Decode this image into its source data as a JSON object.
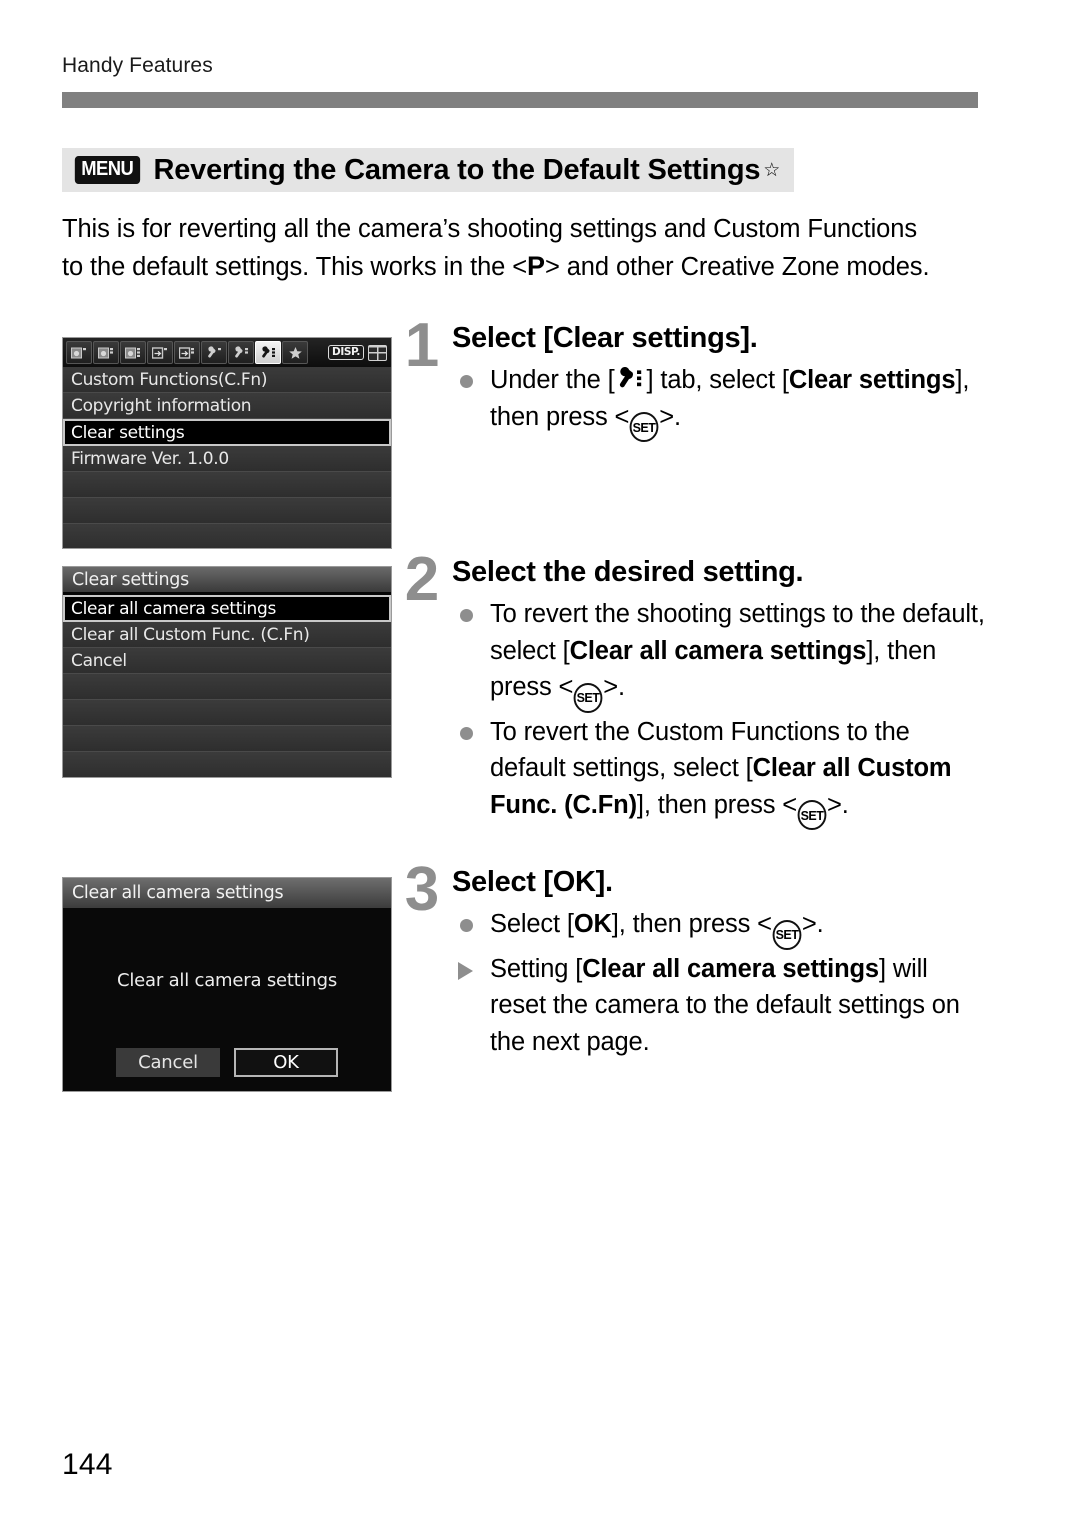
{
  "page": {
    "running_head": "Handy Features",
    "folio": "144",
    "accent_gray": "#808080",
    "title_band_bg": "#e4e4e4"
  },
  "section": {
    "menu_badge": "MENU",
    "title": "Reverting the Camera to the Default Settings",
    "star": "☆"
  },
  "intro": {
    "line1": "This is for reverting all the camera’s shooting settings and Custom",
    "line2_a": "Functions to the default settings. This works in the <",
    "mode_symbol": "P",
    "line2_b": "> and other",
    "line3": "Creative Zone modes."
  },
  "lcd1": {
    "tabs": [
      {
        "name": "shooting-1",
        "state": "dim"
      },
      {
        "name": "shooting-2",
        "state": "dim"
      },
      {
        "name": "shooting-3",
        "state": "dim"
      },
      {
        "name": "playback-1",
        "state": "dim"
      },
      {
        "name": "playback-2",
        "state": "dim"
      },
      {
        "name": "setup-1",
        "state": "dim"
      },
      {
        "name": "setup-2",
        "state": "dim"
      },
      {
        "name": "setup-3",
        "state": "active"
      },
      {
        "name": "my-menu",
        "state": "dim"
      }
    ],
    "disp_label": "DISP.",
    "rows": [
      {
        "label": "Custom Functions(C.Fn)",
        "selected": false
      },
      {
        "label": "Copyright information",
        "selected": false
      },
      {
        "label": "Clear settings",
        "selected": true
      },
      {
        "label": "Firmware Ver. 1.0.0",
        "selected": false
      },
      {
        "label": "",
        "selected": false
      },
      {
        "label": "",
        "selected": false
      },
      {
        "label": "",
        "selected": false
      },
      {
        "label": "",
        "selected": false
      }
    ]
  },
  "lcd2": {
    "title": "Clear settings",
    "rows": [
      {
        "label": "Clear all camera settings",
        "selected": true
      },
      {
        "label": "Clear all Custom Func. (C.Fn)",
        "selected": false
      },
      {
        "label": "Cancel",
        "selected": false
      },
      {
        "label": "",
        "selected": false
      },
      {
        "label": "",
        "selected": false
      },
      {
        "label": "",
        "selected": false
      },
      {
        "label": "",
        "selected": false
      }
    ]
  },
  "lcd3": {
    "header": "Clear all camera settings",
    "message": "Clear all camera settings",
    "cancel_label": "Cancel",
    "ok_label": "OK"
  },
  "steps": {
    "one": {
      "num": "1",
      "heading": "Select [Clear settings].",
      "bullet_a": "Under the [",
      "bullet_b": "] tab, select [",
      "bullet_c_bold": "Clear settings",
      "bullet_d": "], then press <",
      "set_label": "SET",
      "bullet_e": ">."
    },
    "two": {
      "num": "2",
      "heading": "Select the desired setting.",
      "b1_a": "To revert the shooting settings to the default, select [",
      "b1_bold": "Clear all camera settings",
      "b1_b": "], then press <",
      "b1_c": ">.",
      "b2_a": "To revert the Custom Functions to the default settings, select [",
      "b2_bold": "Clear all Custom Func. (C.Fn)",
      "b2_b": "], then press <",
      "b2_c": ">.",
      "set_label": "SET"
    },
    "three": {
      "num": "3",
      "heading": "Select [OK].",
      "b1_a": "Select [",
      "b1_bold": "OK",
      "b1_b": "], then press <",
      "b1_c": ">.",
      "b2_a": "Setting [",
      "b2_bold": "Clear all camera settings",
      "b2_b": "] will reset the camera to the default settings on the next page.",
      "set_label": "SET"
    }
  }
}
